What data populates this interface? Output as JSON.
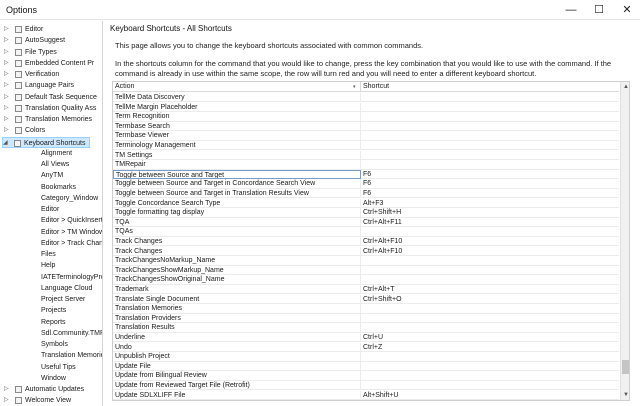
{
  "window": {
    "title": "Options",
    "minimize_glyph": "—",
    "maximize_glyph": "☐",
    "close_glyph": "✕"
  },
  "sidebar": {
    "items": [
      {
        "label": "Editor",
        "expanded": false,
        "child": false
      },
      {
        "label": "AutoSuggest",
        "expanded": false,
        "child": false
      },
      {
        "label": "File Types",
        "expanded": false,
        "child": false
      },
      {
        "label": "Embedded Content Pr",
        "expanded": false,
        "child": false
      },
      {
        "label": "Verification",
        "expanded": false,
        "child": false
      },
      {
        "label": "Language Pairs",
        "expanded": false,
        "child": false
      },
      {
        "label": "Default Task Sequence",
        "expanded": false,
        "child": false
      },
      {
        "label": "Translation Quality Ass",
        "expanded": false,
        "child": false
      },
      {
        "label": "Translation Memories",
        "expanded": false,
        "child": false
      },
      {
        "label": "Colors",
        "expanded": false,
        "child": false
      },
      {
        "label": "Keyboard Shortcuts",
        "expanded": true,
        "child": false,
        "selected": true
      },
      {
        "label": "Alignment",
        "child": true
      },
      {
        "label": "All Views",
        "child": true
      },
      {
        "label": "AnyTM",
        "child": true
      },
      {
        "label": "Bookmarks",
        "child": true
      },
      {
        "label": "Category_Window",
        "child": true
      },
      {
        "label": "Editor",
        "child": true
      },
      {
        "label": "Editor > QuickInsert",
        "child": true
      },
      {
        "label": "Editor > TM Window",
        "child": true
      },
      {
        "label": "Editor > Track Chan",
        "child": true
      },
      {
        "label": "Files",
        "child": true
      },
      {
        "label": "Help",
        "child": true
      },
      {
        "label": "IATETerminologyPro",
        "child": true
      },
      {
        "label": "Language Cloud",
        "child": true
      },
      {
        "label": "Project Server",
        "child": true
      },
      {
        "label": "Projects",
        "child": true
      },
      {
        "label": "Reports",
        "child": true
      },
      {
        "label": "Sdl.Community.TMR",
        "child": true
      },
      {
        "label": "Symbols",
        "child": true
      },
      {
        "label": "Translation Memorie",
        "child": true
      },
      {
        "label": "Useful Tips",
        "child": true
      },
      {
        "label": "Window",
        "child": true
      },
      {
        "label": "Automatic Updates",
        "expanded": false,
        "child": false
      },
      {
        "label": "Welcome View",
        "expanded": false,
        "child": false
      }
    ]
  },
  "panel": {
    "title": "Keyboard Shortcuts - All Shortcuts",
    "description1": "This page allows you to change the keyboard shortcuts associated with common commands.",
    "description2": "In the shortcuts column for the command that you would like to change, press the key combination that you would like to use with the command.  If the command is already in use within the same scope, the row will turn red and you will need to enter a different keyboard shortcut."
  },
  "grid": {
    "columns": {
      "action": "Action",
      "shortcut": "Shortcut"
    },
    "rows": [
      {
        "action": "TellMe Data Discovery",
        "shortcut": ""
      },
      {
        "action": "TellMe Margin Placeholder",
        "shortcut": ""
      },
      {
        "action": "Term Recognition",
        "shortcut": ""
      },
      {
        "action": "Termbase Search",
        "shortcut": ""
      },
      {
        "action": "Termbase Viewer",
        "shortcut": ""
      },
      {
        "action": "Terminology Management",
        "shortcut": ""
      },
      {
        "action": "TM Settings",
        "shortcut": ""
      },
      {
        "action": "TMRepair",
        "shortcut": ""
      },
      {
        "action": "Toggle between Source and Target",
        "shortcut": "F6",
        "focused": true
      },
      {
        "action": "Toggle between Source and Target in Concordance Search View",
        "shortcut": "F6"
      },
      {
        "action": "Toggle between Source and Target in Translation Results View",
        "shortcut": "F6"
      },
      {
        "action": "Toggle Concordance Search Type",
        "shortcut": "Alt+F3"
      },
      {
        "action": "Toggle formatting tag display",
        "shortcut": "Ctrl+Shift+H"
      },
      {
        "action": "TQA",
        "shortcut": "Ctrl+Alt+F11"
      },
      {
        "action": "TQAs",
        "shortcut": ""
      },
      {
        "action": "Track Changes",
        "shortcut": "Ctrl+Alt+F10"
      },
      {
        "action": "Track Changes",
        "shortcut": "Ctrl+Alt+F10"
      },
      {
        "action": "TrackChangesNoMarkup_Name",
        "shortcut": ""
      },
      {
        "action": "TrackChangesShowMarkup_Name",
        "shortcut": ""
      },
      {
        "action": "TrackChangesShowOriginal_Name",
        "shortcut": ""
      },
      {
        "action": "Trademark",
        "shortcut": "Ctrl+Alt+T"
      },
      {
        "action": "Translate Single Document",
        "shortcut": "Ctrl+Shift+O"
      },
      {
        "action": "Translation Memories",
        "shortcut": ""
      },
      {
        "action": "Translation Providers",
        "shortcut": ""
      },
      {
        "action": "Translation Results",
        "shortcut": ""
      },
      {
        "action": "Underline",
        "shortcut": "Ctrl+U"
      },
      {
        "action": "Undo",
        "shortcut": "Ctrl+Z"
      },
      {
        "action": "Unpublish Project",
        "shortcut": ""
      },
      {
        "action": "Update File",
        "shortcut": ""
      },
      {
        "action": "Update from Bilingual Review",
        "shortcut": ""
      },
      {
        "action": "Update from Reviewed Target File (Retrofit)",
        "shortcut": ""
      },
      {
        "action": "Update SDLXLIFF File",
        "shortcut": "Alt+Shift+U"
      }
    ]
  },
  "scrollbar": {
    "up_glyph": "▲",
    "down_glyph": "▼"
  }
}
